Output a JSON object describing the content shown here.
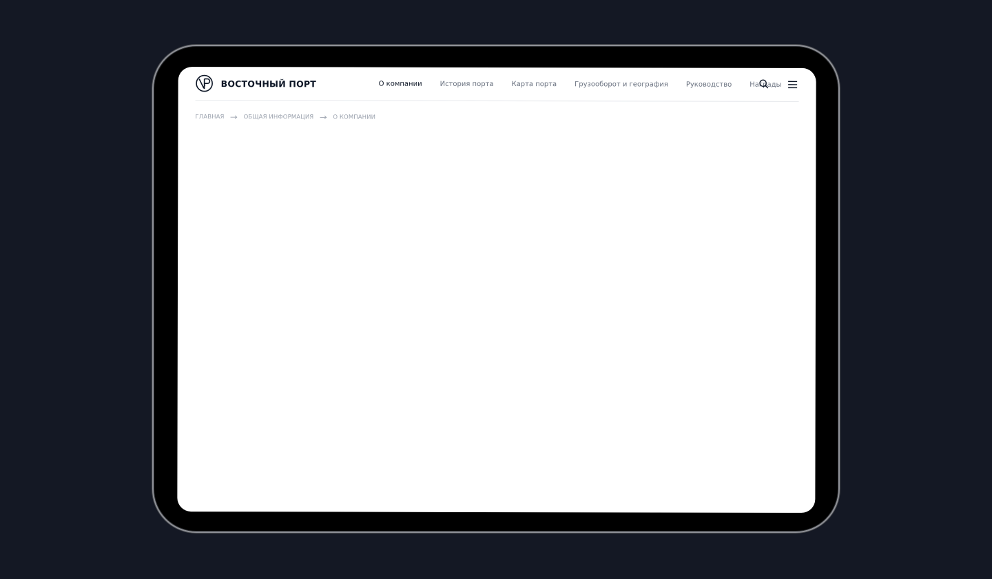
{
  "brand": {
    "name": "ВОСТОЧНЫЙ ПОРТ",
    "logo_icon": "vp-monogram-icon"
  },
  "nav": {
    "items": [
      {
        "label": "О компании",
        "active": true
      },
      {
        "label": "История порта",
        "active": false
      },
      {
        "label": "Карта порта",
        "active": false
      },
      {
        "label": "Грузооборот и география",
        "active": false
      },
      {
        "label": "Руководство",
        "active": false
      },
      {
        "label": "Награды",
        "active": false
      }
    ]
  },
  "header_actions": {
    "search_icon": "search-icon",
    "menu_icon": "hamburger-menu-icon"
  },
  "breadcrumb": {
    "items": [
      "Главная",
      "Общая информация",
      "О компании"
    ],
    "separator_icon": "arrow-right-icon"
  },
  "colors": {
    "background": "#141824",
    "screen": "#ffffff",
    "text_primary": "#0d1626",
    "text_secondary": "#6a7280",
    "breadcrumb": "#9aa1ad"
  }
}
